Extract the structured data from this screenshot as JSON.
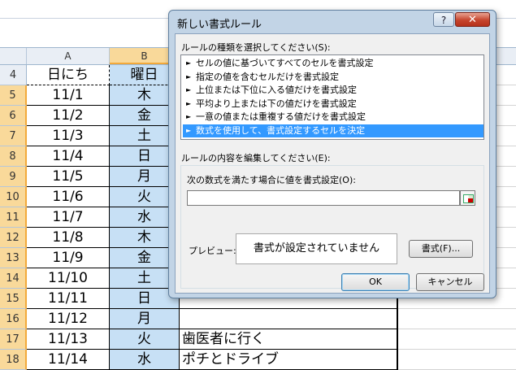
{
  "sheet": {
    "columns": [
      "A",
      "B"
    ],
    "header_row": {
      "row": "4",
      "a": "日にち",
      "b": "曜日"
    },
    "rows": [
      {
        "row": "5",
        "a": "11/1",
        "b": "木",
        "note": ""
      },
      {
        "row": "6",
        "a": "11/2",
        "b": "金",
        "note": ""
      },
      {
        "row": "7",
        "a": "11/3",
        "b": "土",
        "note": ""
      },
      {
        "row": "8",
        "a": "11/4",
        "b": "日",
        "note": ""
      },
      {
        "row": "9",
        "a": "11/5",
        "b": "月",
        "note": ""
      },
      {
        "row": "10",
        "a": "11/6",
        "b": "火",
        "note": ""
      },
      {
        "row": "11",
        "a": "11/7",
        "b": "水",
        "note": ""
      },
      {
        "row": "12",
        "a": "11/8",
        "b": "木",
        "note": ""
      },
      {
        "row": "13",
        "a": "11/9",
        "b": "金",
        "note": ""
      },
      {
        "row": "14",
        "a": "11/10",
        "b": "土",
        "note": ""
      },
      {
        "row": "15",
        "a": "11/11",
        "b": "日",
        "note": ""
      },
      {
        "row": "16",
        "a": "11/12",
        "b": "月",
        "note": ""
      },
      {
        "row": "17",
        "a": "11/13",
        "b": "火",
        "note": "歯医者に行く"
      },
      {
        "row": "18",
        "a": "11/14",
        "b": "水",
        "note": "ポチとドライブ"
      }
    ]
  },
  "dialog": {
    "title": "新しい書式ルール",
    "help": "?",
    "close": "✕",
    "rule_type_label": "ルールの種類を選択してください(S):",
    "rule_types": [
      "セルの値に基づいてすべてのセルを書式設定",
      "指定の値を含むセルだけを書式設定",
      "上位または下位に入る値だけを書式設定",
      "平均より上または下の値だけを書式設定",
      "一意の値または重複する値だけを書式設定",
      "数式を使用して、書式設定するセルを決定"
    ],
    "selected_rule_index": 5,
    "edit_label": "ルールの内容を編集してください(E):",
    "formula_label": "次の数式を満たす場合に値を書式設定(O):",
    "formula_value": "",
    "preview_label": "プレビュー:",
    "preview_text": "書式が設定されていません",
    "format_button": "書式(F)...",
    "ok_button": "OK",
    "cancel_button": "キャンセル"
  }
}
